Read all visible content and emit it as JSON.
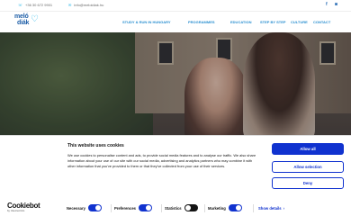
{
  "topbar": {
    "phone": "+36 30 672 9901",
    "email": "info@meloidiak.hu",
    "social": [
      "facebook-icon",
      "instagram-icon"
    ]
  },
  "logo": {
    "line1": "meló",
    "line2": "diák"
  },
  "nav": {
    "items": [
      "STUDY & RUN IN HUNGARY",
      "PROGRAMMES",
      "EDUCATION",
      "STEP BY STEP",
      "CULTURE",
      "CONTACT"
    ]
  },
  "cookie": {
    "title": "This website uses cookies",
    "body": "We use cookies to personalise content and ads, to provide social media features and to analyse our traffic. We also share information about your use of our site with our social media, advertising and analytics partners who may combine it with other information that you've provided to them or that they've collected from your use of their services.",
    "buttons": {
      "allow_all": "Allow all",
      "allow_selection": "Allow selection",
      "deny": "Deny"
    },
    "brand": {
      "name": "Cookiebot",
      "sub": "by Usercentrics"
    },
    "toggles": [
      {
        "label": "Necessary",
        "on": true
      },
      {
        "label": "Preferences",
        "on": true
      },
      {
        "label": "Statistics",
        "on": false
      },
      {
        "label": "Marketing",
        "on": true
      }
    ],
    "details_label": "Show details"
  },
  "colors": {
    "brand_blue": "#1f5fa8",
    "accent_cyan": "#29b8e8",
    "cookie_blue": "#1032cf"
  }
}
